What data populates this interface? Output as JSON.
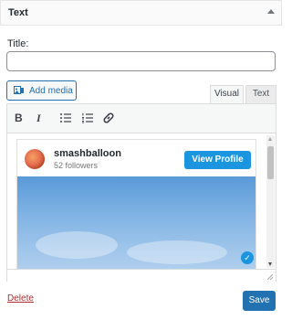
{
  "widget": {
    "title": "Text"
  },
  "form": {
    "title_label": "Title:",
    "title_value": "",
    "add_media_label": "Add media",
    "tabs": [
      {
        "label": "Visual",
        "active": true
      },
      {
        "label": "Text",
        "active": false
      }
    ]
  },
  "toolbar": {
    "bold": "B",
    "italic": "I",
    "bullet_list_icon": "bullet-list-icon",
    "numbered_list_icon": "numbered-list-icon",
    "link_icon": "link-icon"
  },
  "embed": {
    "username": "smashballoon",
    "followers": "52 followers",
    "view_profile_label": "View Profile"
  },
  "actions": {
    "delete_label": "Delete",
    "save_label": "Save"
  },
  "colors": {
    "accent": "#2271b1",
    "instagram_button": "#1b95e0",
    "delete": "#b32d2e"
  }
}
